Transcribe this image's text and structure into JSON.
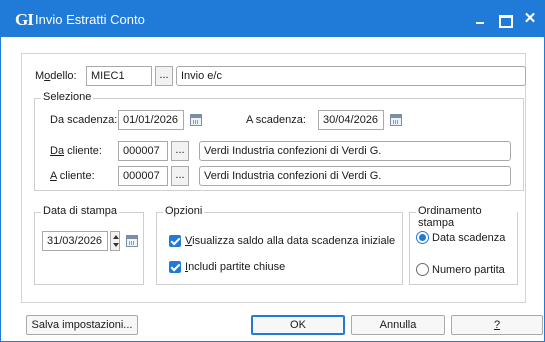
{
  "window": {
    "app_logo": "GI",
    "title": "Invio Estratti Conto",
    "minimize": "",
    "maximize": "",
    "close": "✕"
  },
  "modello": {
    "label_pre": "M",
    "label_underlined": "o",
    "label_post": "dello:",
    "code": "MIEC1",
    "dots": "...",
    "description": "Invio e/c"
  },
  "selezione": {
    "title": "Selezione",
    "da_scadenza_label": "Da scadenza:",
    "da_scadenza_value": "01/01/2026",
    "a_scadenza_label": "A scadenza:",
    "a_scadenza_value": "30/04/2026",
    "da_cliente_label_u": "Da",
    "da_cliente_label_rest": " cliente:",
    "da_cliente_code": "000007",
    "da_cliente_dots": "...",
    "da_cliente_name": "Verdi Industria confezioni di Verdi G.",
    "a_cliente_label_u": "A",
    "a_cliente_label_rest": " cliente:",
    "a_cliente_code": "000007",
    "a_cliente_dots": "...",
    "a_cliente_name": "Verdi Industria confezioni di Verdi G."
  },
  "data_stampa": {
    "title": "Data di stampa",
    "value": "31/03/2026"
  },
  "opzioni": {
    "title": "Opzioni",
    "options": [
      {
        "label_u": "V",
        "label_rest": "isualizza saldo alla data scadenza iniziale",
        "checked": true
      },
      {
        "label_u": "I",
        "label_rest": "ncludi partite chiuse",
        "checked": true
      }
    ]
  },
  "ordinamento": {
    "title": "Ordinamento stampa",
    "options": [
      {
        "label": "Data scadenza",
        "selected": true
      },
      {
        "label": "Numero partita",
        "selected": false
      }
    ]
  },
  "footer": {
    "save_settings": "Salva impostazioni...",
    "ok": "OK",
    "cancel": "Annulla",
    "help": "?"
  },
  "colors": {
    "accent": "#1f7ad8",
    "border": "#a9a9a9"
  }
}
